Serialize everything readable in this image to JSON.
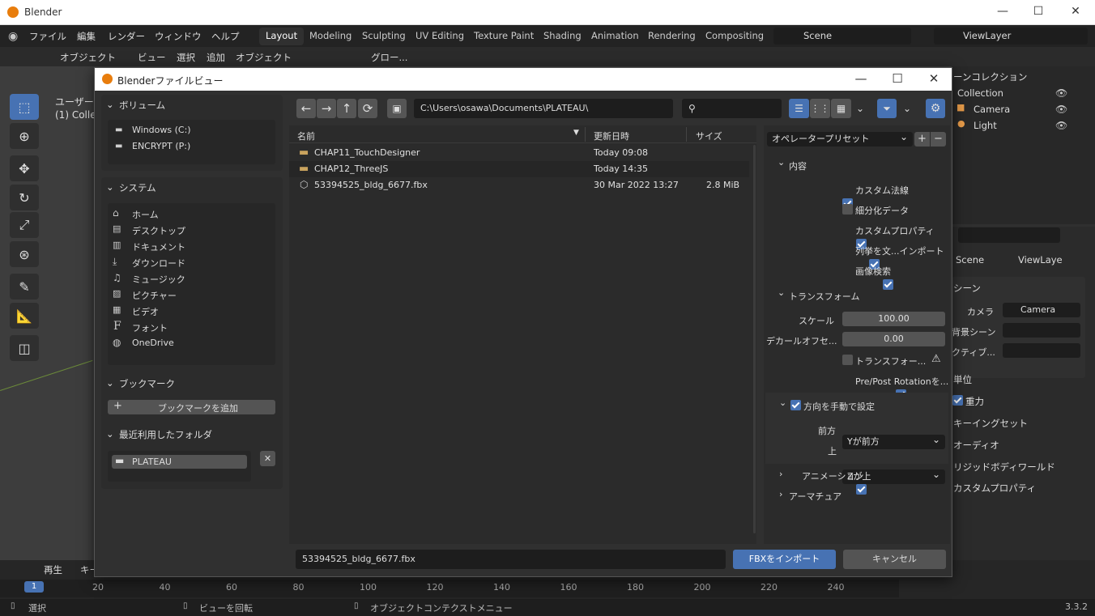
{
  "app": {
    "title": "Blender",
    "version": "3.3.2"
  },
  "menus": [
    "ファイル",
    "編集",
    "レンダー",
    "ウィンドウ",
    "ヘルプ"
  ],
  "workspaces": [
    "Layout",
    "Modeling",
    "Sculpting",
    "UV Editing",
    "Texture Paint",
    "Shading",
    "Animation",
    "Rendering",
    "Compositing"
  ],
  "scene": "Scene",
  "viewlayer": "ViewLayer",
  "header": {
    "mode": "オブジェクト",
    "view": "ビュー",
    "select": "選択",
    "add": "追加",
    "object": "オブジェクト",
    "transform": "グロー..."
  },
  "viewport": {
    "label1": "ユーザー",
    "label2": "(1) Collec"
  },
  "outliner": {
    "title": "ーンコレクション",
    "items": [
      "Collection",
      "Camera",
      "Light"
    ]
  },
  "props": {
    "breadcrumb_scene": "Scene",
    "breadcrumb_layer": "ViewLaye",
    "section": "シーン",
    "camera_label": "カメラ",
    "camera_value": "Camera",
    "bg_label": "背景シーン",
    "active_label": "クティブ...",
    "units": "単位",
    "gravity": "重力",
    "keying": "キーイングセット",
    "audio": "オーディオ",
    "rigid": "リジッドボディワールド",
    "custom": "カスタムプロパティ"
  },
  "timeline": {
    "playback": "再生",
    "keying": "キー",
    "current_frame": "1",
    "ticks": [
      "20",
      "40",
      "60",
      "80",
      "100",
      "120",
      "140",
      "160",
      "180",
      "200",
      "220",
      "240"
    ]
  },
  "status": {
    "select": "選択",
    "rotate": "ビューを回転",
    "context": "オブジェクトコンテクストメニュー"
  },
  "dialog": {
    "title": "Blenderファイルビュー",
    "path": "C:\\Users\\osawa\\Documents\\PLATEAU\\",
    "volumes": {
      "title": "ボリューム",
      "items": [
        "Windows (C:)",
        "ENCRYPT (P:)"
      ]
    },
    "system": {
      "title": "システム",
      "items": [
        "ホーム",
        "デスクトップ",
        "ドキュメント",
        "ダウンロード",
        "ミュージック",
        "ピクチャー",
        "ビデオ",
        "フォント",
        "OneDrive"
      ]
    },
    "bookmarks": {
      "title": "ブックマーク",
      "add": "ブックマークを追加"
    },
    "recent": {
      "title": "最近利用したフォルダ",
      "items": [
        "PLATEAU"
      ]
    },
    "columns": {
      "name": "名前",
      "date": "更新日時",
      "size": "サイズ"
    },
    "files": [
      {
        "name": "CHAP11_TouchDesigner",
        "date": "Today 09:08",
        "size": "",
        "type": "folder"
      },
      {
        "name": "CHAP12_ThreeJS",
        "date": "Today 14:35",
        "size": "",
        "type": "folder"
      },
      {
        "name": "53394525_bldg_6677.fbx",
        "date": "30 Mar 2022 13:27",
        "size": "2.8 MiB",
        "type": "file"
      }
    ],
    "filename": "53394525_bldg_6677.fbx",
    "import_button": "FBXをインポート",
    "cancel_button": "キャンセル",
    "options": {
      "preset": "オペレータープリセット",
      "include": "内容",
      "include_items": [
        {
          "label": "カスタム法線",
          "checked": true
        },
        {
          "label": "細分化データ",
          "checked": false
        },
        {
          "label": "カスタムプロパティ",
          "checked": true
        },
        {
          "label": "列挙を文...インポート",
          "checked": true
        },
        {
          "label": "画像検索",
          "checked": true
        }
      ],
      "transform": "トランスフォーム",
      "scale_label": "スケール",
      "scale_value": "100.00",
      "decal_label": "デカールオフセ...",
      "decal_value": "0.00",
      "apply_transform": "トランスフォー...",
      "prepost": "Pre/Post Rotationを...",
      "manual_orient": "方向を手動で設定",
      "forward_label": "前方",
      "forward_value": "Yが前方",
      "up_label": "上",
      "up_value": "Zが上",
      "animation": "アニメーション",
      "armature": "アーマチュア"
    }
  }
}
